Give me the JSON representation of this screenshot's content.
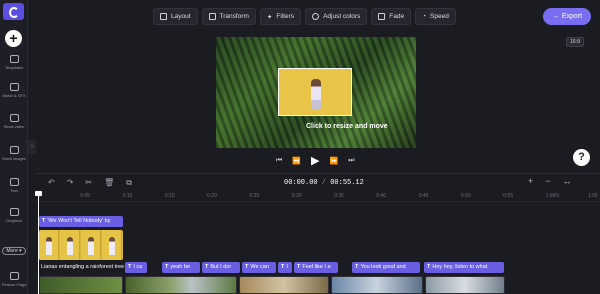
{
  "sidebar": {
    "items": [
      {
        "label": "Templates",
        "icon": "templates-icon"
      },
      {
        "label": "Music & SFX",
        "icon": "music-icon"
      },
      {
        "label": "Stock video",
        "icon": "stock-video-icon"
      },
      {
        "label": "Stock images",
        "icon": "stock-images-icon"
      },
      {
        "label": "Text",
        "icon": "text-icon"
      },
      {
        "label": "Graphics",
        "icon": "graphics-icon"
      },
      {
        "label": "Feature Flags",
        "icon": "feature-flags-icon"
      }
    ],
    "more_label": "More"
  },
  "toolbar": {
    "buttons": [
      "Layout",
      "Transform",
      "Filters",
      "Adjust colors",
      "Fade",
      "Speed"
    ],
    "export_label": "Export",
    "aspect_ratio": "16:9"
  },
  "preview": {
    "hint": "Click to resize and move"
  },
  "timeline": {
    "timecode_current": "00:00.00",
    "timecode_sep": " / ",
    "timecode_total": "00:55.12",
    "ruler_ticks": [
      "0",
      "0:05",
      "0:10",
      "0:15",
      "0:20",
      "0:25",
      "0:30",
      "0:35",
      "0:40",
      "0:45",
      "0:50",
      "0:55",
      "1 MIN",
      "1:05"
    ],
    "title_clip": "'We Won't Tell Nobody' by",
    "video_clip_label": "Lianas entangling a rainforest tree",
    "caption_clips": [
      "I ca",
      "yeah be",
      "But I dor",
      "We can",
      "I",
      "Feel like I a",
      "You look good and",
      "Hey hey, listen to what"
    ]
  },
  "colors": {
    "accent": "#7a6ef0",
    "text_clip": "#6a5fe2",
    "background": "#1b1c22"
  }
}
